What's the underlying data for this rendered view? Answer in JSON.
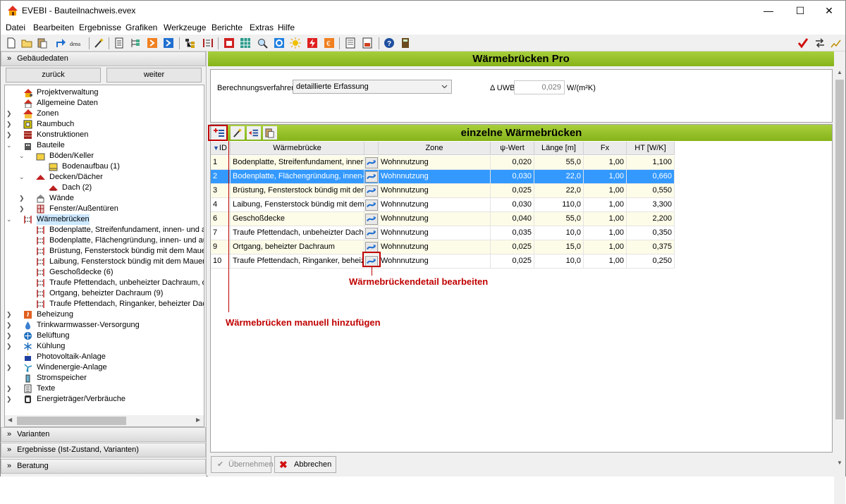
{
  "window": {
    "title": "EVEBI - Bauteilnachweis.evex",
    "minimize": "—",
    "maximize": "☐",
    "close": "✕"
  },
  "menu": [
    "Datei",
    "Bearbeiten",
    "Ergebnisse",
    "Grafiken",
    "Werkzeuge",
    "Berichte",
    "Extras",
    "Hilfe"
  ],
  "left": {
    "header": "Gebäudedaten",
    "back": "zurück",
    "next": "weiter",
    "tree": [
      {
        "label": "Projektverwaltung"
      },
      {
        "label": "Allgemeine Daten"
      },
      {
        "label": "Zonen"
      },
      {
        "label": "Raumbuch"
      },
      {
        "label": "Konstruktionen"
      },
      {
        "label": "Bauteile"
      },
      {
        "label": "Böden/Keller"
      },
      {
        "label": "Bodenaufbau (1)"
      },
      {
        "label": "Decken/Dächer"
      },
      {
        "label": "Dach (2)"
      },
      {
        "label": "Wände"
      },
      {
        "label": "Fenster/Außentüren"
      },
      {
        "label": "Wärmebrücken"
      },
      {
        "label": "Bodenplatte, Streifenfundament, innen- und auße"
      },
      {
        "label": "Bodenplatte, Flächengründung, innen- und außen"
      },
      {
        "label": "Brüstung, Fensterstock bündig mit dem Mauerwerk"
      },
      {
        "label": "Laibung, Fensterstock bündig mit dem Mauerwerk"
      },
      {
        "label": "Geschoßdecke (6)"
      },
      {
        "label": "Traufe Pfettendach, unbeheizter Dachraum, ober"
      },
      {
        "label": "Ortgang, beheizter Dachraum (9)"
      },
      {
        "label": "Traufe Pfettendach, Ringanker, beheizter Dachra"
      },
      {
        "label": "Beheizung"
      },
      {
        "label": "Trinkwarmwasser-Versorgung"
      },
      {
        "label": "Belüftung"
      },
      {
        "label": "Kühlung"
      },
      {
        "label": "Photovoltaik-Anlage"
      },
      {
        "label": "Windenergie-Anlage"
      },
      {
        "label": "Stromspeicher"
      },
      {
        "label": "Texte"
      },
      {
        "label": "Energieträger/Verbräuche"
      }
    ],
    "sections": [
      "Varianten",
      "Ergebnisse (Ist-Zustand, Varianten)",
      "Beratung"
    ]
  },
  "main": {
    "title": "Wärmebrücken Pro",
    "method_label": "Berechnungsverfahren",
    "method_value": "detaillierte Erfassung",
    "delta_label": "Δ UWB",
    "delta_value": "0,029",
    "delta_unit": "W/(m²K)",
    "subtitle": "einzelne Wärmebrücken",
    "columns": [
      "ID",
      "Wärmebrücke",
      "Zone",
      "ψ-Wert",
      "Länge [m]",
      "Fx",
      "HT [W/K]"
    ],
    "rows": [
      {
        "id": "1",
        "name": "Bodenplatte, Streifenfundament, inner…",
        "zone": "Wohnnutzung",
        "psi": "0,020",
        "len": "55,0",
        "fx": "1,00",
        "ht": "1,100"
      },
      {
        "id": "2",
        "name": "Bodenplatte, Flächengründung, innen-…",
        "zone": "Wohnnutzung",
        "psi": "0,030",
        "len": "22,0",
        "fx": "1,00",
        "ht": "0,660"
      },
      {
        "id": "3",
        "name": "Brüstung, Fensterstock bündig mit dem…",
        "zone": "Wohnnutzung",
        "psi": "0,025",
        "len": "22,0",
        "fx": "1,00",
        "ht": "0,550"
      },
      {
        "id": "4",
        "name": "Laibung, Fensterstock bündig mit dem l…",
        "zone": "Wohnnutzung",
        "psi": "0,030",
        "len": "110,0",
        "fx": "1,00",
        "ht": "3,300"
      },
      {
        "id": "6",
        "name": "Geschoßdecke",
        "zone": "Wohnnutzung",
        "psi": "0,040",
        "len": "55,0",
        "fx": "1,00",
        "ht": "2,200"
      },
      {
        "id": "7",
        "name": "Traufe Pfettendach, unbeheizter Dach…",
        "zone": "Wohnnutzung",
        "psi": "0,035",
        "len": "10,0",
        "fx": "1,00",
        "ht": "0,350"
      },
      {
        "id": "9",
        "name": "Ortgang, beheizter Dachraum",
        "zone": "Wohnnutzung",
        "psi": "0,025",
        "len": "15,0",
        "fx": "1,00",
        "ht": "0,375"
      },
      {
        "id": "10",
        "name": "Traufe Pfettendach, Ringanker, beheiz…",
        "zone": "Wohnnutzung",
        "psi": "0,025",
        "len": "10,0",
        "fx": "1,00",
        "ht": "0,250"
      }
    ],
    "apply": "Übernehmen",
    "cancel": "Abbrechen"
  },
  "annotations": {
    "edit": "Wärmebrückendetail bearbeiten",
    "add": "Wärmebrücken manuell hinzufügen"
  },
  "colors": {
    "green": "#94c11f",
    "select": "#3399ff",
    "annotation": "#c00000"
  }
}
